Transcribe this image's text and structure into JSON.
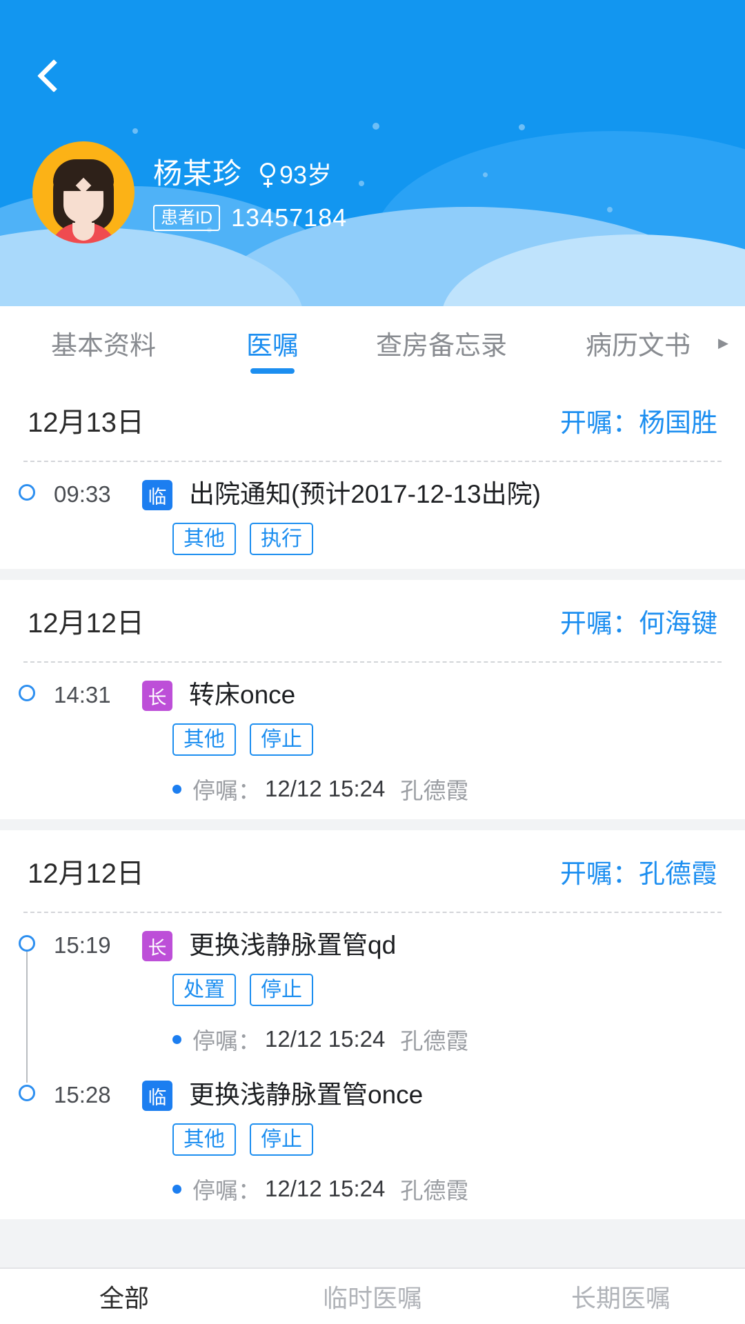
{
  "header": {
    "back_icon": "chevron-left-icon",
    "avatar_icon": "patient-avatar-female",
    "patient_name": "杨某珍",
    "gender_icon": "female-gender-icon",
    "age": "93岁",
    "id_label": "患者ID",
    "id_value": "13457184",
    "brand_color": "#1296f0"
  },
  "tabs": [
    {
      "label": "基本资料",
      "active": false
    },
    {
      "label": "医嘱",
      "active": true
    },
    {
      "label": "查房备忘录",
      "active": false
    },
    {
      "label": "病历文书",
      "active": false
    }
  ],
  "tab_more_icon": "chevron-right-icon",
  "cards": [
    {
      "date": "12月13日",
      "doctor": "开嘱：杨国胜",
      "orders": [
        {
          "time": "09:33",
          "type_badge": "临",
          "type_kind": "lin",
          "title": "出院通知(预计2017-12-13出院)",
          "tags": [
            "其他",
            "执行"
          ],
          "note": null
        }
      ]
    },
    {
      "date": "12月12日",
      "doctor": "开嘱：何海键",
      "orders": [
        {
          "time": "14:31",
          "type_badge": "长",
          "type_kind": "chang",
          "title": "转床once",
          "tags": [
            "其他",
            "停止"
          ],
          "note": {
            "label": "停嘱：",
            "time": "12/12 15:24",
            "person": "孔德霞"
          }
        }
      ]
    },
    {
      "date": "12月12日",
      "doctor": "开嘱：孔德霞",
      "orders": [
        {
          "time": "15:19",
          "type_badge": "长",
          "type_kind": "chang",
          "title": "更换浅静脉置管qd",
          "tags": [
            "处置",
            "停止"
          ],
          "note": {
            "label": "停嘱：",
            "time": "12/12 15:24",
            "person": "孔德霞"
          }
        },
        {
          "time": "15:28",
          "type_badge": "临",
          "type_kind": "lin",
          "title": "更换浅静脉置管once",
          "tags": [
            "其他",
            "停止"
          ],
          "note": {
            "label": "停嘱：",
            "time": "12/12 15:24",
            "person": "孔德霞"
          }
        }
      ]
    }
  ],
  "bottom_nav": [
    {
      "label": "全部",
      "active": true
    },
    {
      "label": "临时医嘱",
      "active": false
    },
    {
      "label": "长期医嘱",
      "active": false
    }
  ]
}
